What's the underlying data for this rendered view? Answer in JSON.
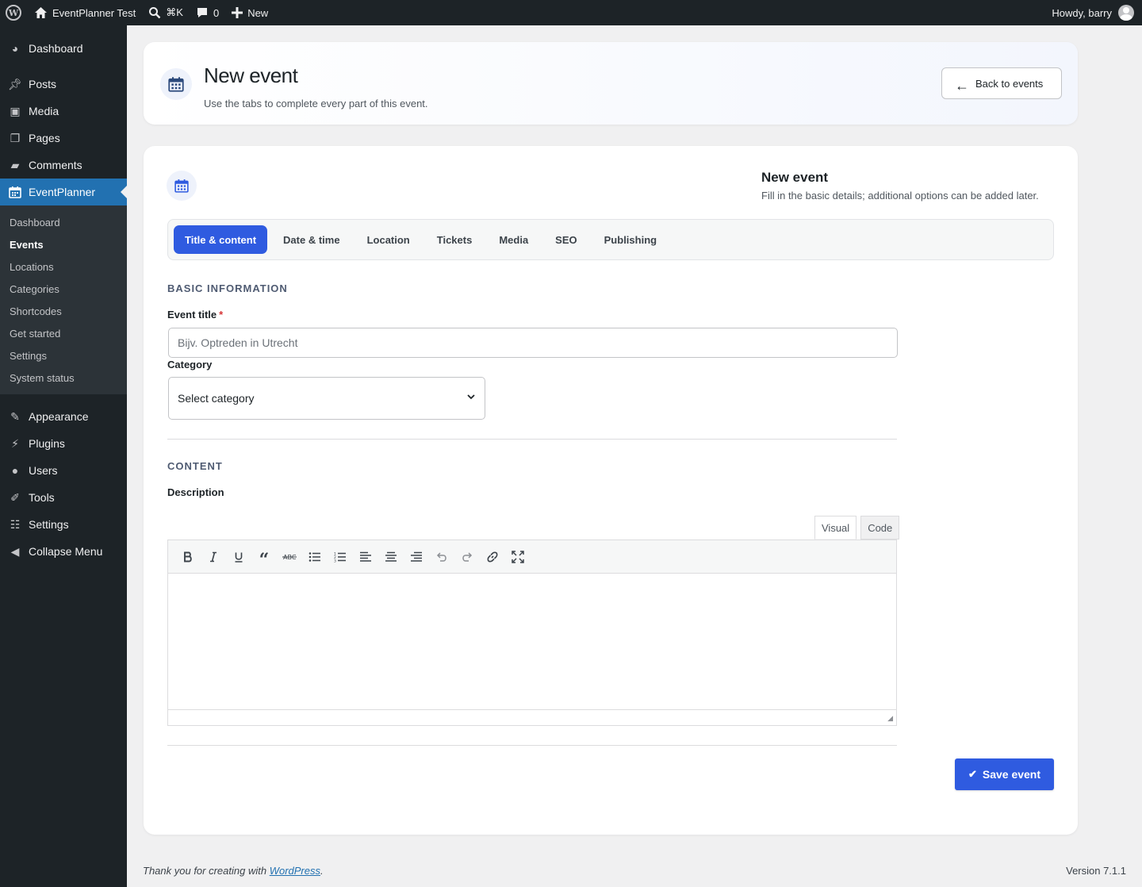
{
  "adminbar": {
    "site_name": "EventPlanner Test",
    "search_shortcut": "⌘K",
    "comments_count": "0",
    "new_label": "New",
    "howdy": "Howdy, barry"
  },
  "sidebar": {
    "items_top": [
      {
        "label": "Dashboard",
        "icon": "dashboard-icon"
      },
      {
        "label": "Posts",
        "icon": "pin-icon"
      },
      {
        "label": "Media",
        "icon": "media-icon"
      },
      {
        "label": "Pages",
        "icon": "pages-icon"
      },
      {
        "label": "Comments",
        "icon": "comment-icon"
      },
      {
        "label": "EventPlanner",
        "icon": "calendar-icon"
      }
    ],
    "submenu": [
      "Dashboard",
      "Events",
      "Locations",
      "Categories",
      "Shortcodes",
      "Get started",
      "Settings",
      "System status"
    ],
    "items_bottom": [
      {
        "label": "Appearance",
        "icon": "brush-icon"
      },
      {
        "label": "Plugins",
        "icon": "plug-icon"
      },
      {
        "label": "Users",
        "icon": "user-icon"
      },
      {
        "label": "Tools",
        "icon": "wrench-icon"
      },
      {
        "label": "Settings",
        "icon": "sliders-icon"
      },
      {
        "label": "Collapse Menu",
        "icon": "collapse-icon"
      }
    ]
  },
  "header": {
    "title": "New event",
    "subtitle": "Use the tabs to complete every part of this event.",
    "back_label": "Back to events"
  },
  "card": {
    "title": "New event",
    "subtitle": "Fill in the basic details; additional options can be added later.",
    "tabs": [
      "Title & content",
      "Date & time",
      "Location",
      "Tickets",
      "Media",
      "SEO",
      "Publishing"
    ],
    "active_tab": "Title & content"
  },
  "form": {
    "basic_heading": "BASIC INFORMATION",
    "title_label": "Event title",
    "required_mark": "*",
    "title_placeholder": "Bijv. Optreden in Utrecht",
    "title_value": "",
    "category_label": "Category",
    "category_selected": "Select category",
    "content_heading": "CONTENT",
    "description_label": "Description",
    "editor_tab_visual": "Visual",
    "editor_tab_code": "Code",
    "save_label": "Save event"
  },
  "footer": {
    "thanks_prefix": "Thank you for creating with ",
    "thanks_link": "WordPress",
    "thanks_suffix": ".",
    "version": "Version 7.1.1"
  },
  "colors": {
    "primary": "#2f5be0",
    "admin_dark": "#1d2327",
    "wp_blue": "#2271b1",
    "required": "#d63638"
  }
}
